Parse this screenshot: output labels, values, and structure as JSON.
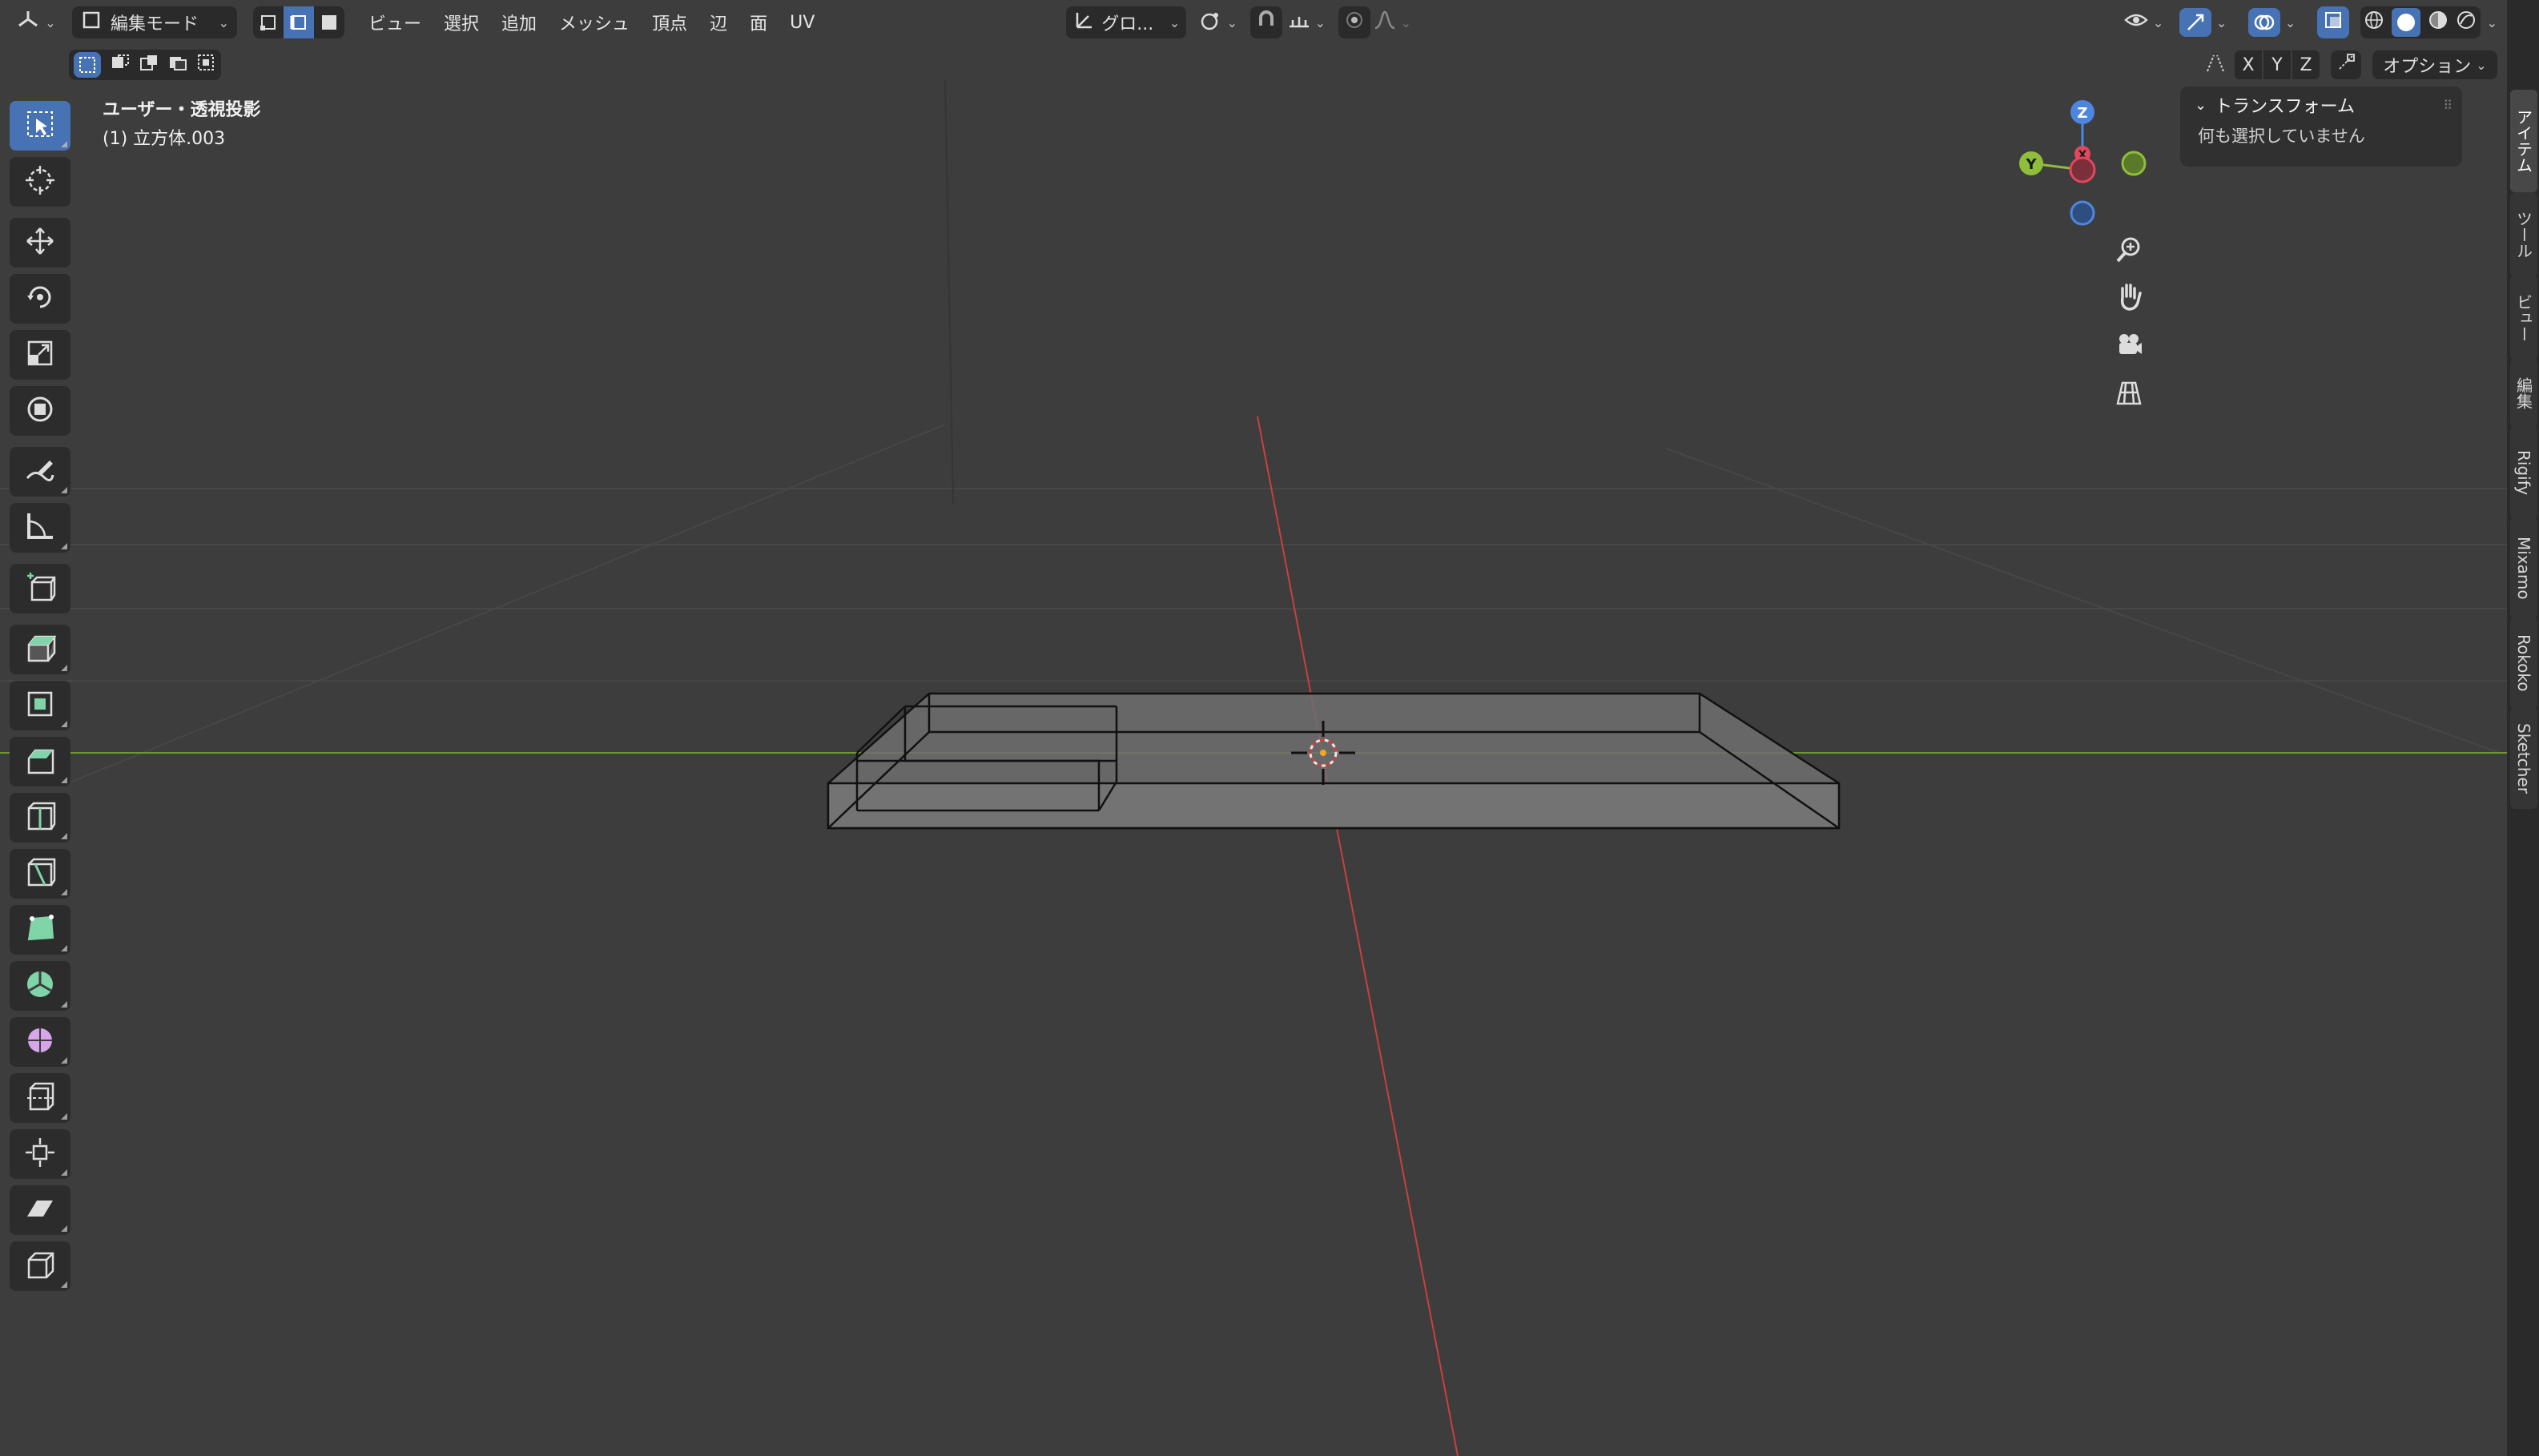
{
  "header": {
    "editor_type_icon": "3d-viewport-icon",
    "mode_label": "編集モード",
    "select_modes": [
      "vertex-select-icon",
      "edge-select-icon",
      "face-select-icon"
    ],
    "menus": [
      "ビュー",
      "選択",
      "追加",
      "メッシュ",
      "頂点",
      "辺",
      "面",
      "UV"
    ],
    "transform_orientation": "グロ...",
    "pivot_icon": "pivot-icon",
    "snap_icon": "snap-icon",
    "proportional_icon": "proportional-icon",
    "falloff_icon": "falloff-icon"
  },
  "subheader": {
    "axes": [
      "X",
      "Y",
      "Z"
    ],
    "options_label": "オプション"
  },
  "overlay_info": {
    "view_name": "ユーザー・透視投影",
    "object_name": "(1) 立方体.003"
  },
  "gizmo": {
    "axes": {
      "x": "X",
      "y": "Y",
      "z": "Z"
    },
    "colors": {
      "x": "#e0485c",
      "y": "#8fbe3b",
      "z": "#4d86e0"
    }
  },
  "npanel": {
    "section_title": "トランスフォーム",
    "empty_message": "何も選択していません",
    "tabs": [
      "アイテム",
      "ツール",
      "ビュー",
      "編集",
      "Rigify",
      "Mixamo",
      "Rokoko",
      "Sketcher"
    ]
  },
  "colors": {
    "background": "#3d3d3d",
    "active": "#4772b3",
    "x_axis": "#c7413e",
    "y_axis": "#6a9a2c",
    "mesh_fill": "#6f6f6f"
  },
  "tools": [
    "select-box-icon",
    "cursor-icon",
    "move-icon",
    "rotate-icon",
    "scale-icon",
    "transform-icon",
    "annotate-icon",
    "measure-icon",
    "add-cube-icon",
    "extrude-icon",
    "inset-icon",
    "bevel-icon",
    "loop-cut-icon",
    "knife-icon",
    "poly-build-icon",
    "spin-icon",
    "smooth-icon",
    "edge-slide-icon",
    "shrink-fatten-icon",
    "shear-icon",
    "rip-icon"
  ]
}
